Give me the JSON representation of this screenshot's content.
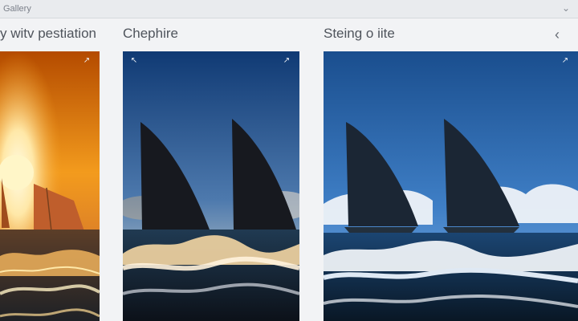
{
  "app": {
    "title": "Gallery"
  },
  "panels": [
    {
      "title": "y witv pestiation"
    },
    {
      "title": "Chephire"
    },
    {
      "title": "Steing o iite"
    }
  ],
  "icons": {
    "top": "chevron-down-icon",
    "back": "chevron-left-icon",
    "expand_left": "expand-arrow-icon",
    "expand_right": "expand-arrow-icon"
  },
  "colors": {
    "sunset_top": "#b44b00",
    "sunset_mid": "#f39b1d",
    "sunset_light": "#ffe8a8",
    "dusk_sky_top": "#103a74",
    "dusk_sky_bottom": "#e1a55f",
    "clear_sky_top": "#1a4e8e",
    "clear_sky_bottom": "#86b4e6",
    "sail_dark": "#17191f",
    "wave_white": "#f4f7fb"
  }
}
